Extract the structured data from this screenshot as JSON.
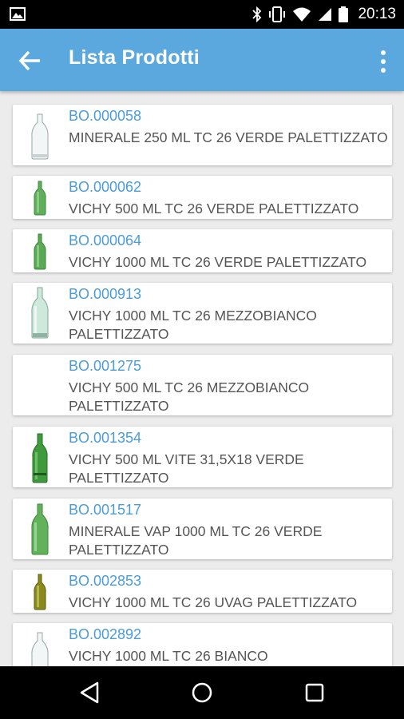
{
  "status_bar": {
    "time": "20:13",
    "icons": [
      "image-notification-icon",
      "bluetooth-icon",
      "vibrate-icon",
      "wifi-icon",
      "signal-icon",
      "battery-icon"
    ]
  },
  "app_bar": {
    "title": "Lista Prodotti",
    "back_icon": "arrow-back-icon",
    "menu_icon": "more-vert-icon",
    "color": "#5aa8de"
  },
  "products": [
    {
      "code": "BO.000058",
      "name": "MINERALE 250 ML TC 26 VERDE PALETTIZZATO",
      "bottle": "clear"
    },
    {
      "code": "BO.000062",
      "name": "VICHY 500 ML TC 26 VERDE PALETTIZZATO",
      "bottle": "green"
    },
    {
      "code": "BO.000064",
      "name": "VICHY 1000 ML TC 26 VERDE PALETTIZZATO",
      "bottle": "green"
    },
    {
      "code": "BO.000913",
      "name": "VICHY 1000 ML TC 26 MEZZOBIANCO PALETTIZZATO",
      "bottle": "pale-green"
    },
    {
      "code": "BO.001275",
      "name": "VICHY 500 ML TC 26 MEZZOBIANCO PALETTIZZATO",
      "bottle": "none"
    },
    {
      "code": "BO.001354",
      "name": "VICHY 500 ML VITE 31,5X18 VERDE PALETTIZZATO",
      "bottle": "green"
    },
    {
      "code": "BO.001517",
      "name": "MINERALE VAP 1000 ML TC 26 VERDE PALETTIZZATO",
      "bottle": "green"
    },
    {
      "code": "BO.002853",
      "name": "VICHY 1000 ML TC 26 UVAG PALETTIZZATO",
      "bottle": "olive"
    },
    {
      "code": "BO.002892",
      "name": "VICHY 1000 ML TC 26 BIANCO",
      "bottle": "clear"
    }
  ],
  "nav_bar": {
    "icons": [
      "back-triangle-icon",
      "home-circle-icon",
      "recents-square-icon"
    ]
  }
}
